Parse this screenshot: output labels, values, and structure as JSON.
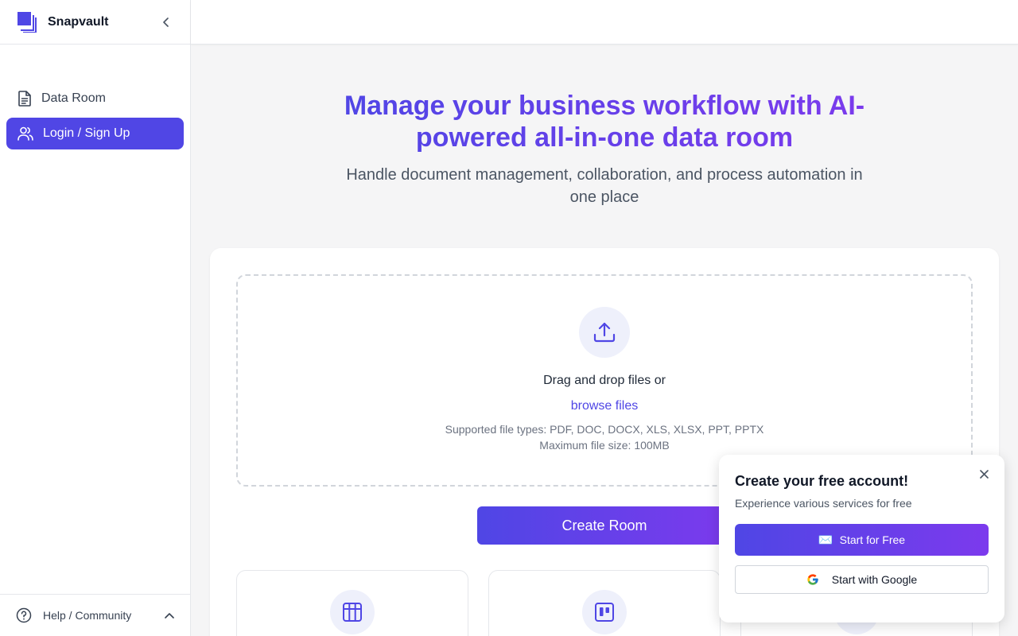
{
  "app": {
    "name": "Snapvault"
  },
  "sidebar": {
    "items": [
      {
        "label": "Data Room",
        "icon": "document-icon",
        "active": false
      },
      {
        "label": "Login / Sign Up",
        "icon": "users-icon",
        "active": true
      }
    ],
    "footer": {
      "label": "Help / Community"
    }
  },
  "hero": {
    "title": "Manage your business workflow with AI-powered all-in-one data room",
    "subtitle": "Handle document management, collaboration, and process automation in one place"
  },
  "dropzone": {
    "text": "Drag and drop files or",
    "browse": "browse files",
    "supported": "Supported file types: PDF, DOC, DOCX, XLS, XLSX, PPT, PPTX",
    "max_size": "Maximum file size: 100MB"
  },
  "create_button": "Create Room",
  "popup": {
    "title": "Create your free account!",
    "subtitle": "Experience various services for free",
    "primary_label": "Start for Free",
    "google_label": "Start with Google"
  },
  "colors": {
    "accent": "#5046e5",
    "accent_end": "#7c3aed"
  }
}
